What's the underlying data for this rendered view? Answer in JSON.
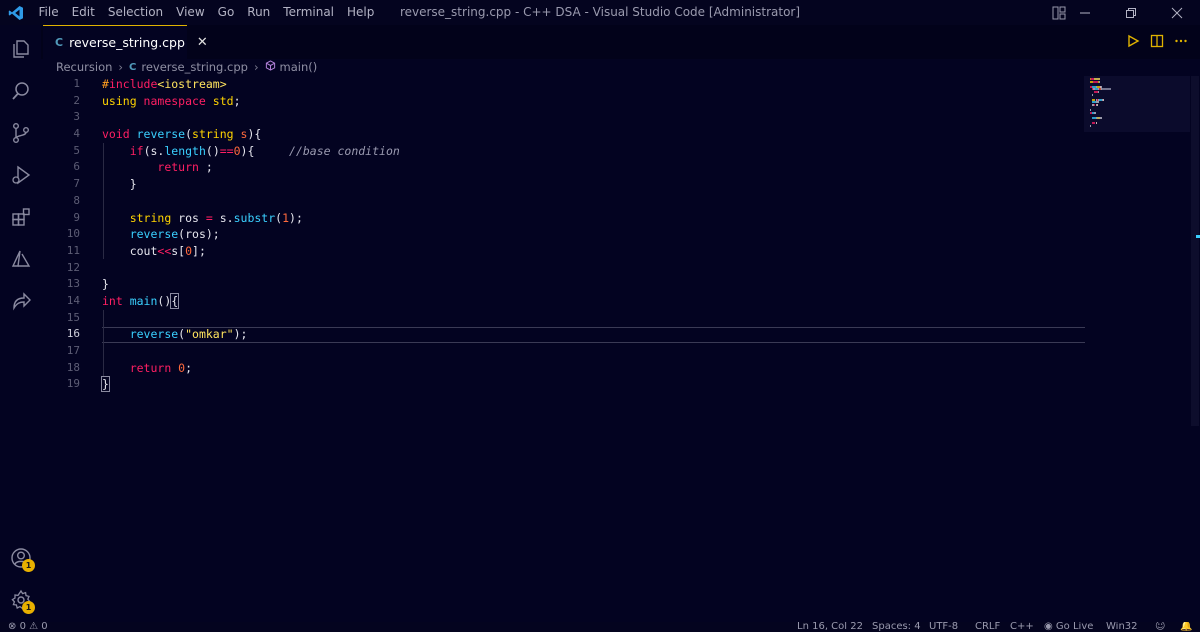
{
  "titlebar": {
    "menu": [
      "File",
      "Edit",
      "Selection",
      "View",
      "Go",
      "Run",
      "Terminal",
      "Help"
    ],
    "title": "reverse_string.cpp - C++ DSA - Visual Studio Code [Administrator]"
  },
  "activity": {
    "icons": [
      "files-icon",
      "search-icon",
      "source-control-icon",
      "run-debug-icon",
      "extensions-icon",
      "azure-icon",
      "live-share-icon"
    ],
    "accounts_badge": "1",
    "settings_badge": "1"
  },
  "tab": {
    "icon": "C",
    "label": "reverse_string.cpp",
    "close": "✕"
  },
  "breadcrumb": {
    "folder": "Recursion",
    "icon": "C",
    "file": "reverse_string.cpp",
    "symbol": "main()"
  },
  "editor": {
    "active_line": 16,
    "line_numbers": [
      "1",
      "2",
      "3",
      "4",
      "5",
      "6",
      "7",
      "8",
      "9",
      "10",
      "11",
      "12",
      "13",
      "14",
      "15",
      "16",
      "17",
      "18",
      "19"
    ]
  },
  "statusbar": {
    "errors": "0",
    "warnings": "0",
    "position": "Ln 16, Col 22",
    "spaces": "Spaces: 4",
    "encoding": "UTF-8",
    "eol": "CRLF",
    "language": "C++",
    "golive": "Go Live",
    "platform": "Win32"
  },
  "colors": {
    "background": "#030321",
    "keyword": "#ff1f63",
    "type": "#ffd400",
    "function": "#3ad0ff",
    "badge": "#e8b000",
    "tab_border": "#e0b300"
  }
}
